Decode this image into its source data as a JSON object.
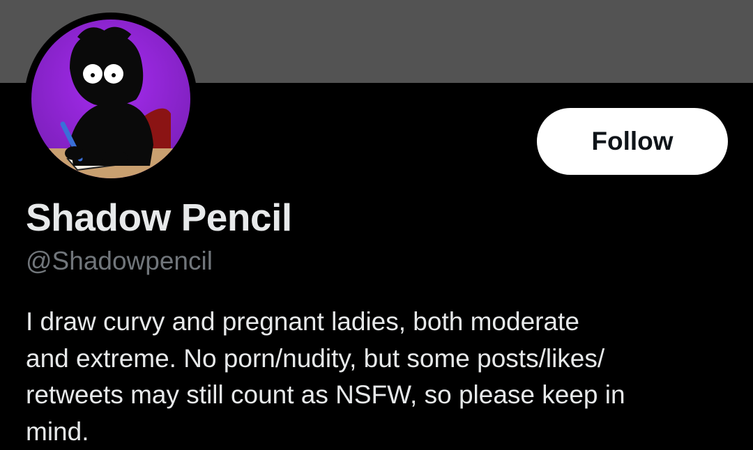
{
  "profile": {
    "display_name": "Shadow Pencil",
    "handle": "@Shadowpencil",
    "bio_lines": [
      "I draw curvy and pregnant ladies, both moderate",
      "and extreme. No porn/nudity, but some posts/likes/",
      "retweets may still count as NSFW, so please keep in",
      "mind."
    ],
    "avatar_icon": "shadow-character-drawing-avatar"
  },
  "actions": {
    "follow_label": "Follow"
  },
  "colors": {
    "banner": "#535353",
    "background": "#000000",
    "primary_text": "#e7e9ea",
    "secondary_text": "#71767b",
    "follow_button_bg": "#ffffff",
    "avatar_bg": "#8a2be2"
  }
}
